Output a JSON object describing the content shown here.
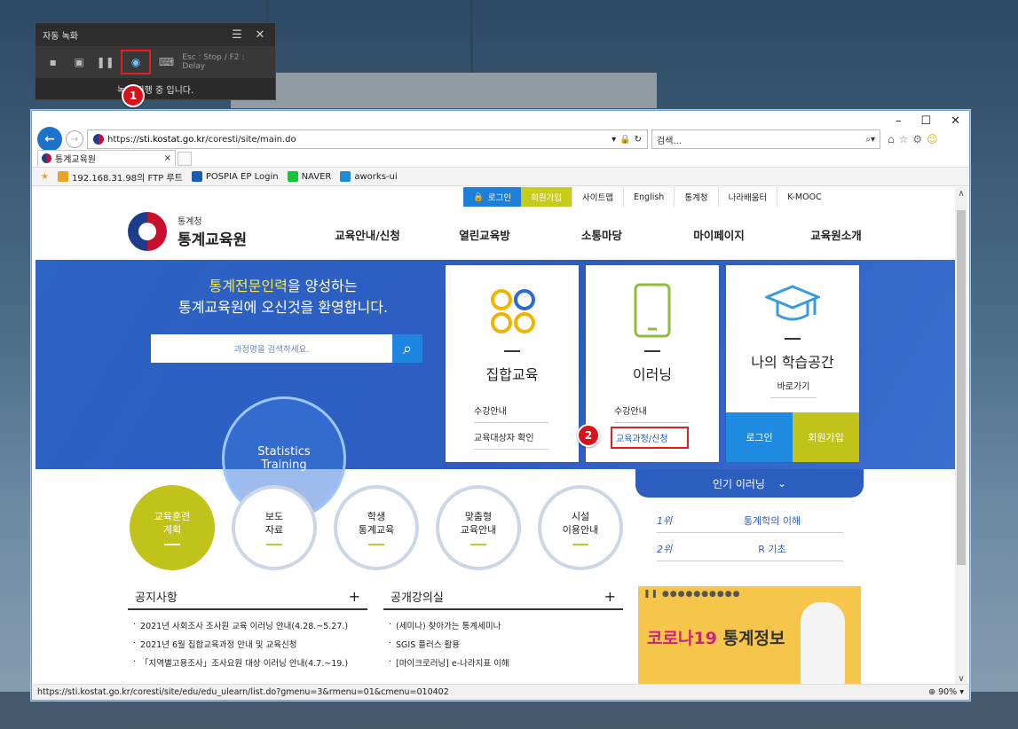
{
  "recorder": {
    "title": "자동 녹화",
    "hint": "Esc : Stop / F2 : Delay",
    "status": "녹화 진행 중 입니다."
  },
  "badges": [
    "1",
    "2"
  ],
  "browser": {
    "url_prefix": "https://",
    "url_host": "sti.kostat.go.kr",
    "url_path": "/coresti/site/main.do",
    "search_placeholder": "검색...",
    "tab_title": "통계교육원",
    "favorites": [
      {
        "label": "192.168.31.98의 FTP 루트",
        "color": "#e8a32b"
      },
      {
        "label": "POSPIA EP Login",
        "color": "#1d5bb5"
      },
      {
        "label": "NAVER",
        "color": "#19c337"
      },
      {
        "label": "aworks-ui",
        "color": "#1e8bd6"
      }
    ],
    "status_url": "https://sti.kostat.go.kr/coresti/site/edu/edu_ulearn/list.do?gmenu=3&rmenu=01&cmenu=010402",
    "zoom": "90%"
  },
  "page": {
    "util": [
      "로그인",
      "회원가입",
      "사이트맵",
      "English",
      "통계청",
      "나라배움터",
      "K-MOOC"
    ],
    "logo_small": "통계청",
    "logo_big": "통계교육원",
    "gnb": [
      "교육안내/신청",
      "열린교육방",
      "소통마당",
      "마이페이지",
      "교육원소개"
    ],
    "hero_line1_hl": "통계전문인력",
    "hero_line1_rest": "을 양성하는",
    "hero_line2": "통계교육원에 오신것을 환영합니다.",
    "search_placeholder": "과정명을 검색하세요.",
    "globe_line1": "Statistics",
    "globe_line2": "Training",
    "card1": {
      "title": "집합교육",
      "link1": "수강안내",
      "link2": "교육대상자 확인"
    },
    "card2": {
      "title": "이러닝",
      "link1": "수강안내",
      "link2": "교육과정/신청"
    },
    "card3": {
      "title": "나의 학습공간",
      "link1": "바로가기",
      "btn1": "로그인",
      "btn2": "회원가입"
    },
    "popular": "인기 이러닝",
    "circles": [
      {
        "l1": "교육훈련",
        "l2": "계획"
      },
      {
        "l1": "보도",
        "l2": "자료"
      },
      {
        "l1": "학생",
        "l2": "통계교육"
      },
      {
        "l1": "맞춤형",
        "l2": "교육안내"
      },
      {
        "l1": "시설",
        "l2": "이용안내"
      }
    ],
    "ranks": [
      {
        "n": "1위",
        "t": "통계학의 이해"
      },
      {
        "n": "2위",
        "t": "R 기초"
      }
    ],
    "notice": {
      "title": "공지사항",
      "items": [
        "2021년 사회조사 조사원 교육 이러닝 안내(4.28.~5.27.)",
        "2021년 6월 집합교육과정 안내 및 교육신청",
        "「지역별고용조사」조사요원 대상 이러닝 안내(4.7.~19.)"
      ]
    },
    "lecture": {
      "title": "공개강의실",
      "items": [
        "(세미나) 찾아가는 통계세미나",
        "SGIS 플러스 활용",
        "[마이크로러닝] e-나라지표 이해"
      ]
    },
    "banner_hl": "코로나19",
    "banner_rest": " 통계정보"
  },
  "colors": {
    "accent": "#1e7fd8",
    "lime": "#c6cb1c",
    "hero": "#2c5ec0",
    "red": "#d8121b"
  }
}
